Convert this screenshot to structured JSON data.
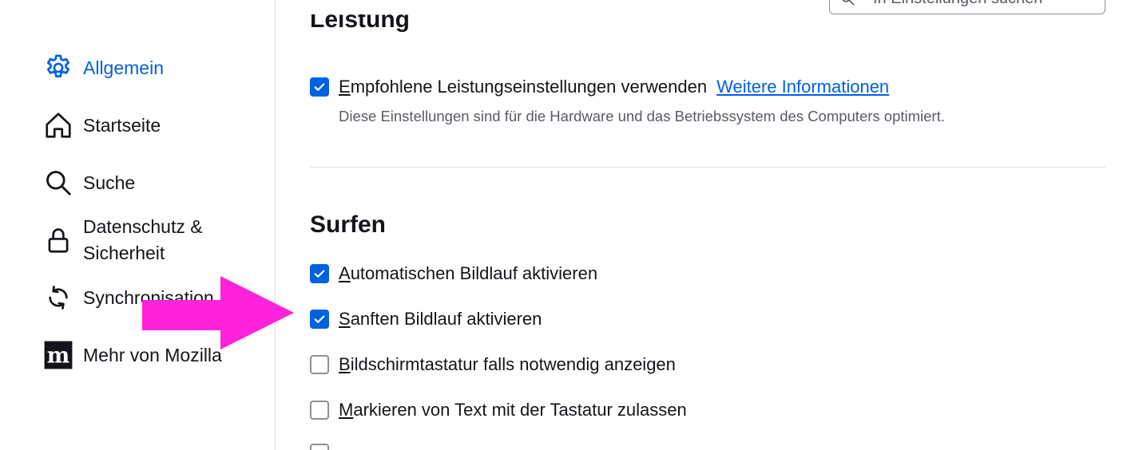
{
  "sidebar": {
    "items": [
      {
        "label": "Allgemein",
        "icon": "gear-icon",
        "selected": true
      },
      {
        "label": "Startseite",
        "icon": "home-icon"
      },
      {
        "label": "Suche",
        "icon": "search-icon"
      },
      {
        "label": "Datenschutz & Sicherheit",
        "icon": "lock-icon"
      },
      {
        "label": "Synchronisation",
        "icon": "sync-icon"
      },
      {
        "label": "Mehr von Mozilla",
        "icon": "mozilla-icon"
      }
    ]
  },
  "search": {
    "placeholder": "In Einstellungen suchen"
  },
  "performance": {
    "heading_cut": "Leistung",
    "recommended": {
      "accesskey": "E",
      "label_rest": "mpfohlene Leistungseinstellungen verwenden",
      "checked": true,
      "link": "Weitere Informationen"
    },
    "description": "Diese Einstellungen sind für die Hardware und das Betriebssystem des Computers optimiert."
  },
  "browsing": {
    "title": "Surfen",
    "options": [
      {
        "accesskey": "A",
        "rest": "utomatischen Bildlauf aktivieren",
        "checked": true
      },
      {
        "accesskey": "S",
        "rest": "anften Bildlauf aktivieren",
        "checked": true
      },
      {
        "accesskey": "B",
        "rest": "ildschirmtastatur falls notwendig anzeigen",
        "checked": false
      },
      {
        "accesskey": "M",
        "rest": "arkieren von Text mit der Tastatur zulassen",
        "checked": false
      }
    ]
  },
  "colors": {
    "accent": "#0061e0",
    "arrow": "#ff22dd",
    "text": "#15141a",
    "muted": "#5b5b66"
  }
}
